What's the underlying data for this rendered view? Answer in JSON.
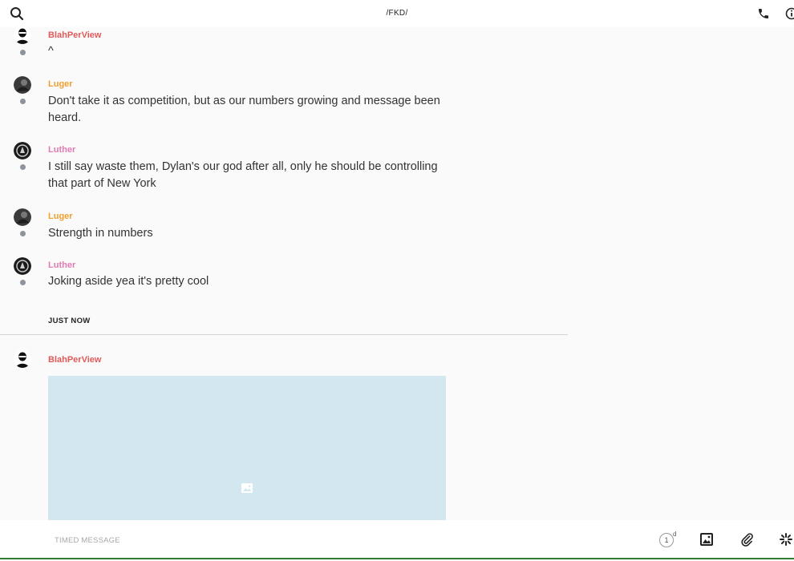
{
  "header": {
    "title": "/FKD/"
  },
  "messages": [
    {
      "author": "BlahPerView",
      "author_color": "#e05a5a",
      "text": "^"
    },
    {
      "author": "Luger",
      "author_color": "#f0a030",
      "text": "Don't take it as competition, but as our numbers growing and message  been heard."
    },
    {
      "author": "Luther",
      "author_color": "#e07ab3",
      "text": "I still say waste them, Dylan's our god after all, only he should be controlling that part of New York"
    },
    {
      "author": "Luger",
      "author_color": "#f0a030",
      "text": "Strength in numbers"
    },
    {
      "author": "Luther",
      "author_color": "#e07ab3",
      "text": "Joking aside yea it's pretty cool"
    }
  ],
  "divider": {
    "label": "JUST NOW"
  },
  "latest_message": {
    "author": "BlahPerView",
    "author_color": "#e05a5a"
  },
  "footer": {
    "placeholder": "TIMED MESSAGE",
    "timer_value": "1",
    "timer_unit": "d"
  },
  "icons": {
    "search": "search-icon",
    "phone": "phone-icon",
    "info": "info-icon",
    "image": "image-icon",
    "attachment": "paperclip-icon",
    "sparkle": "sparkle-icon"
  }
}
